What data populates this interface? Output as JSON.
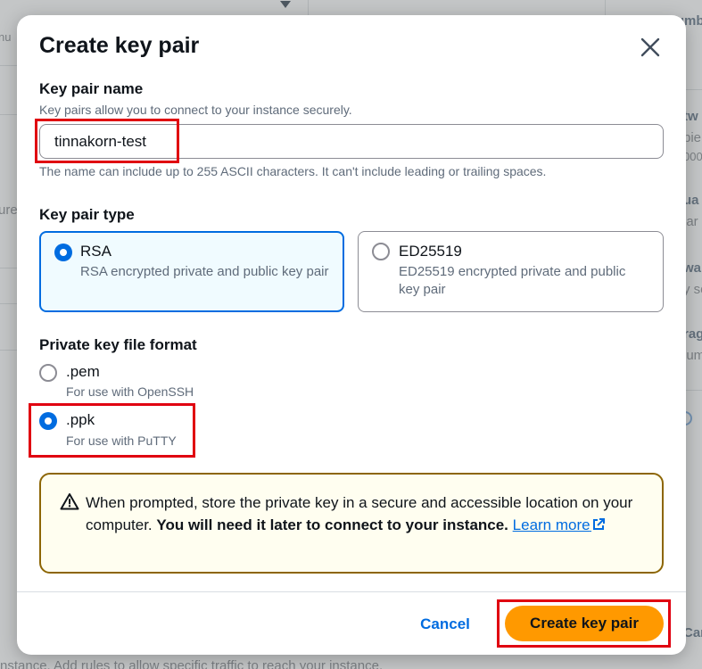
{
  "background": {
    "fragments": [
      "nu",
      "Numb",
      "tw",
      "bie",
      "000",
      "ua",
      "lar",
      "wa",
      "y se",
      "rag",
      "lum",
      "ure",
      "Car"
    ],
    "bottom_text": "nstance. Add rules to allow specific traffic to reach your instance."
  },
  "modal": {
    "title": "Create key pair",
    "close_icon": "close-icon",
    "key_pair_name": {
      "label": "Key pair name",
      "description": "Key pairs allow you to connect to your instance securely.",
      "value": "tinnakorn-test",
      "hint": "The name can include up to 255 ASCII characters. It can't include leading or trailing spaces."
    },
    "key_pair_type": {
      "label": "Key pair type",
      "options": [
        {
          "title": "RSA",
          "description": "RSA encrypted private and public key pair",
          "selected": true
        },
        {
          "title": "ED25519",
          "description": "ED25519 encrypted private and public key pair",
          "selected": false
        }
      ]
    },
    "private_key_format": {
      "label": "Private key file format",
      "options": [
        {
          "title": ".pem",
          "description": "For use with OpenSSH",
          "selected": false
        },
        {
          "title": ".ppk",
          "description": "For use with PuTTY",
          "selected": true
        }
      ]
    },
    "alert": {
      "icon": "warning-icon",
      "text_start": "When prompted, store the private key in a secure and accessible location on your computer.",
      "text_bold": "You will need it later to connect to your instance.",
      "link_label": "Learn more",
      "link_icon": "external-link-icon"
    },
    "buttons": {
      "cancel": "Cancel",
      "create": "Create key pair"
    }
  },
  "colors": {
    "accent": "#006ce0",
    "primary_button": "#ff9900",
    "highlight_box": "#e00010",
    "alert_border": "#8d6605",
    "selected_tile_bg": "#f0fbff"
  }
}
